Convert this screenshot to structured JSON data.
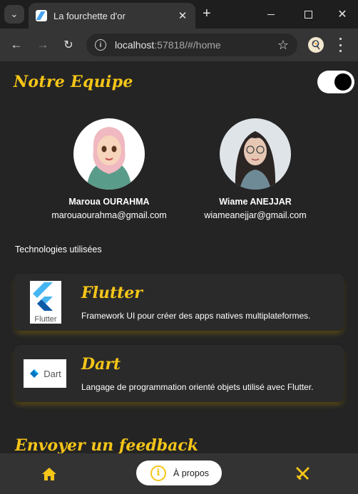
{
  "browser": {
    "tab_title": "La fourchette d'or",
    "url_host": "localhost",
    "url_rest": ":57818/#/home",
    "icons": {
      "tab_search": "chevron-down-icon",
      "tab_close": "close-icon",
      "new_tab": "plus-icon",
      "back": "arrow-left-icon",
      "forward": "arrow-right-icon",
      "reload": "reload-icon",
      "site_info": "info-icon",
      "bookmark": "star-icon",
      "menu": "more-vertical-icon"
    }
  },
  "header": {
    "title": "Notre Equipe",
    "theme_toggle_on": true
  },
  "team": [
    {
      "name": "Maroua OURAHMA",
      "email": "marouaourahma@gmail.com"
    },
    {
      "name": "Wiame ANEJJAR",
      "email": "wiameanejjar@gmail.com"
    }
  ],
  "technologies": {
    "label": "Technologies utilisées",
    "items": [
      {
        "name": "Flutter",
        "logo_text": "Flutter",
        "description": "Framework UI pour créer des apps natives multiplateformes."
      },
      {
        "name": "Dart",
        "logo_text": "Dart",
        "description": "Langage de programmation orienté objets utilisé avec Flutter."
      }
    ]
  },
  "feedback": {
    "title": "Envoyer un feedback"
  },
  "bottom_nav": {
    "home_icon": "home-icon",
    "about_label": "À propos",
    "about_icon": "info-icon",
    "menu_icon": "fork-knife-icon"
  },
  "colors": {
    "accent": "#f5c518",
    "background": "#242424",
    "card": "#2a2a2a",
    "bottom_bar": "#333333"
  }
}
